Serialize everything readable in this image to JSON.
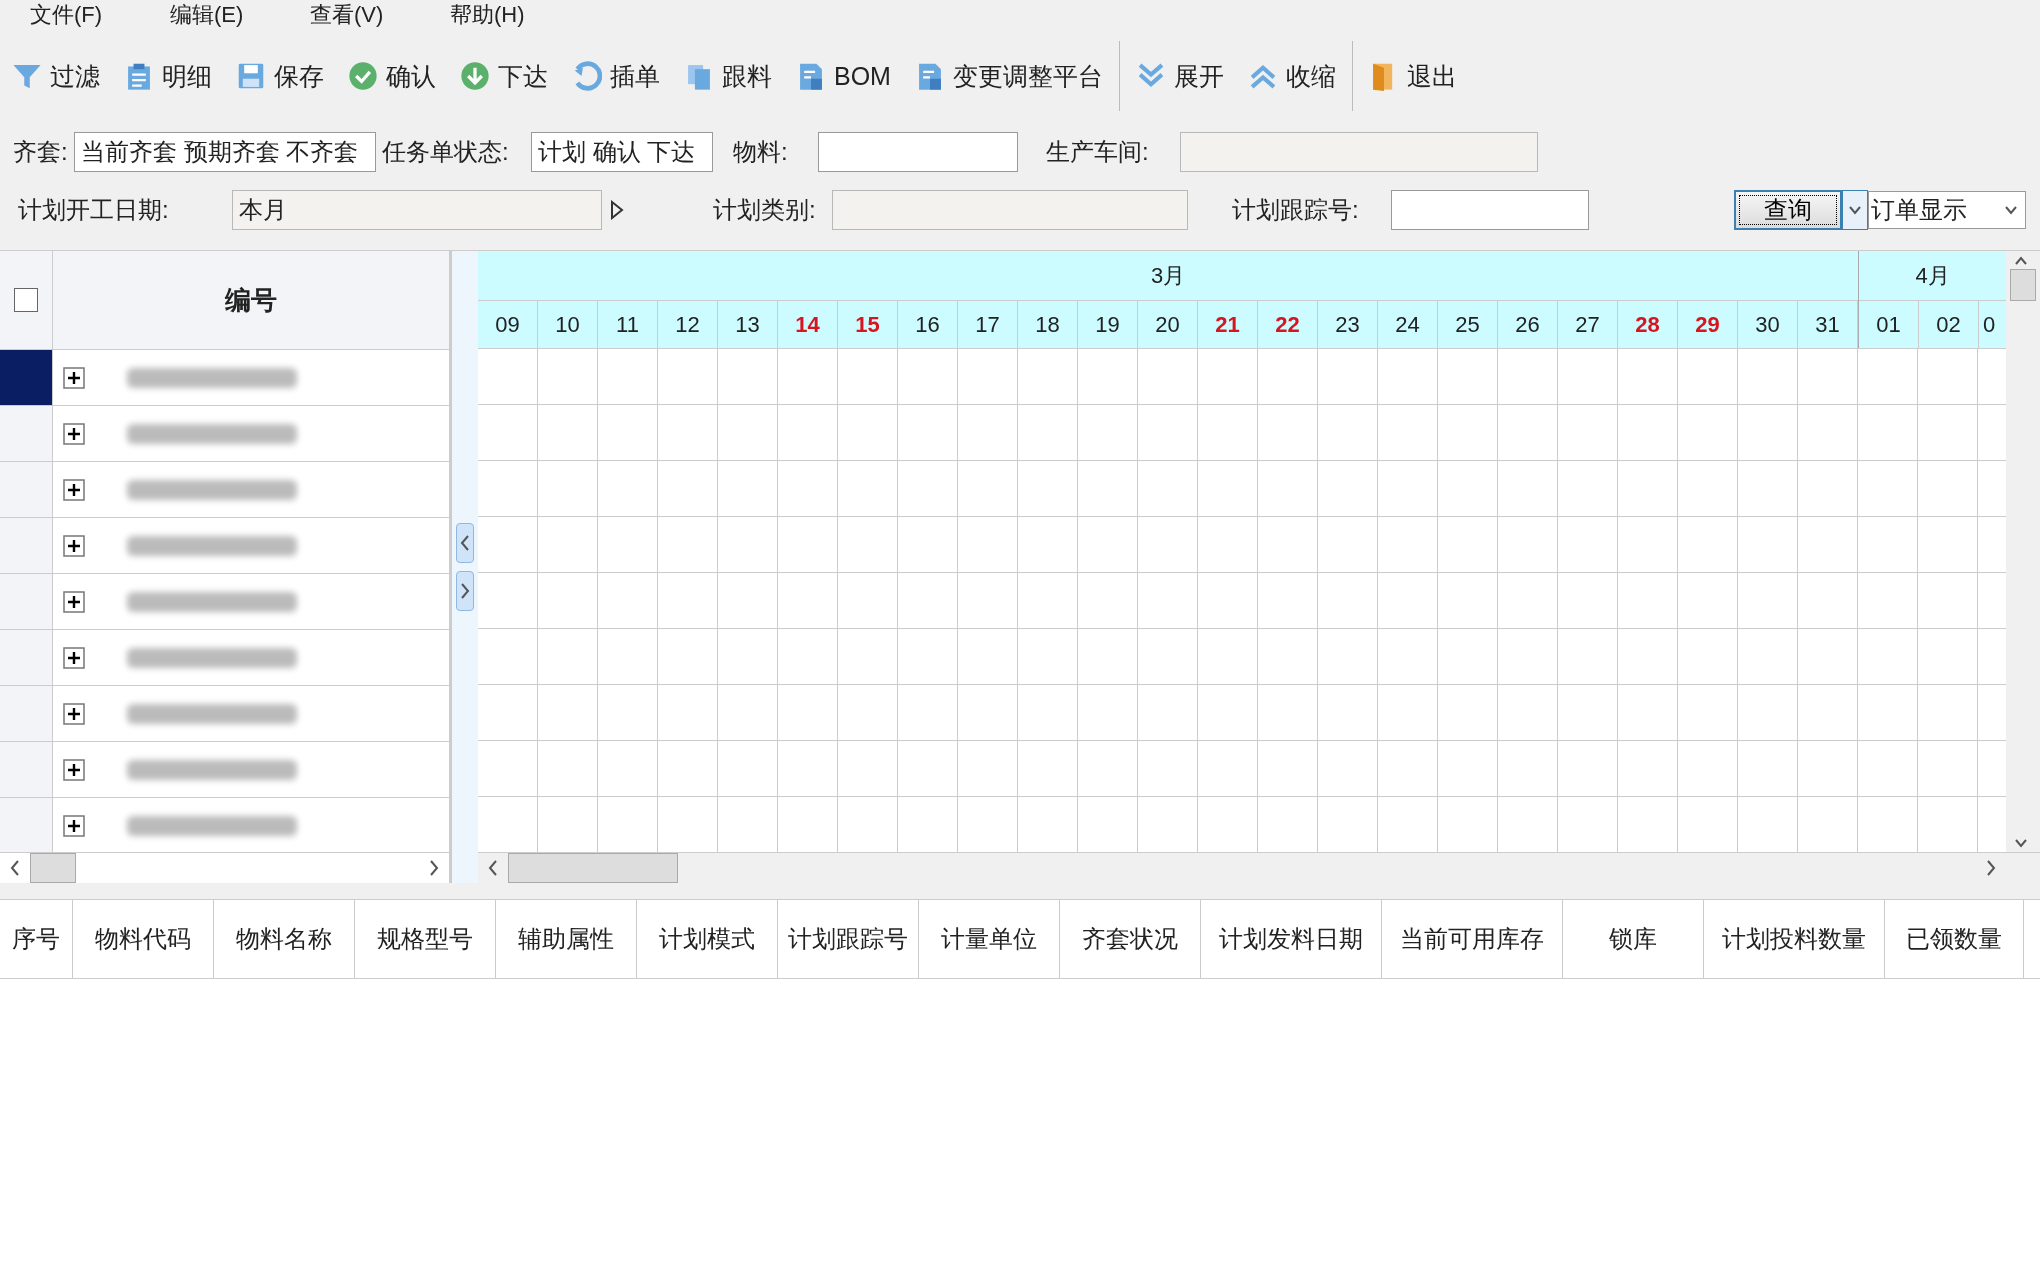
{
  "menu": [
    "文件(F)",
    "编辑(E)",
    "查看(V)",
    "帮助(H)"
  ],
  "toolbar": [
    {
      "kind": "filter",
      "label": "过滤"
    },
    {
      "kind": "clipboard",
      "label": "明细"
    },
    {
      "kind": "save",
      "label": "保存"
    },
    {
      "kind": "check",
      "label": "确认"
    },
    {
      "kind": "down",
      "label": "下达"
    },
    {
      "kind": "insert",
      "label": "插单"
    },
    {
      "kind": "copy",
      "label": "跟料"
    },
    {
      "kind": "doc",
      "label": "BOM"
    },
    {
      "kind": "doc",
      "label": "变更调整平台"
    },
    {
      "kind": "sep"
    },
    {
      "kind": "expand",
      "label": "展开"
    },
    {
      "kind": "collapse",
      "label": "收缩"
    },
    {
      "kind": "sep"
    },
    {
      "kind": "exit",
      "label": "退出"
    }
  ],
  "filters": {
    "row1": [
      {
        "label": "齐套:",
        "value": "当前齐套 预期齐套 不齐套",
        "disabled": false
      },
      {
        "label": "任务单状态:",
        "value": "计划 确认 下达",
        "disabled": false
      },
      {
        "label": "物料:",
        "disabled": false
      },
      {
        "label": "生产车间:",
        "disabled": true
      }
    ],
    "row2": [
      {
        "label": "计划开工日期:",
        "value": "本月",
        "disabled": true,
        "arrow": true
      },
      {
        "label": "计划类别:",
        "disabled": true
      },
      {
        "label": "计划跟踪号:",
        "disabled": false
      }
    ],
    "query_button": "查询",
    "view_select": "订单显示"
  },
  "grid": {
    "header": "编号",
    "checked": false,
    "rows": [
      {
        "selected": true
      },
      {
        "selected": false
      },
      {
        "selected": false
      },
      {
        "selected": false
      },
      {
        "selected": false
      },
      {
        "selected": false
      },
      {
        "selected": false
      },
      {
        "selected": false
      },
      {
        "selected": false
      }
    ]
  },
  "calendar": {
    "months": [
      {
        "label": "3月",
        "days": [
          {
            "label": "09",
            "weekend": false
          },
          {
            "label": "10",
            "weekend": false
          },
          {
            "label": "11",
            "weekend": false
          },
          {
            "label": "12",
            "weekend": false
          },
          {
            "label": "13",
            "weekend": false
          },
          {
            "label": "14",
            "weekend": true
          },
          {
            "label": "15",
            "weekend": true
          },
          {
            "label": "16",
            "weekend": false
          },
          {
            "label": "17",
            "weekend": false
          },
          {
            "label": "18",
            "weekend": false
          },
          {
            "label": "19",
            "weekend": false
          },
          {
            "label": "20",
            "weekend": false
          },
          {
            "label": "21",
            "weekend": true
          },
          {
            "label": "22",
            "weekend": true
          },
          {
            "label": "23",
            "weekend": false
          },
          {
            "label": "24",
            "weekend": false
          },
          {
            "label": "25",
            "weekend": false
          },
          {
            "label": "26",
            "weekend": false
          },
          {
            "label": "27",
            "weekend": false
          },
          {
            "label": "28",
            "weekend": true
          },
          {
            "label": "29",
            "weekend": true
          },
          {
            "label": "30",
            "weekend": false
          },
          {
            "label": "31",
            "weekend": false
          }
        ]
      },
      {
        "label": "4月",
        "days": [
          {
            "label": "01",
            "weekend": false
          },
          {
            "label": "02",
            "weekend": false
          },
          {
            "label": "0",
            "weekend": false
          }
        ]
      }
    ]
  },
  "detail_table": {
    "columns": [
      "序号",
      "物料代码",
      "物料名称",
      "规格型号",
      "辅助属性",
      "计划模式",
      "计划跟踪号",
      "计量单位",
      "齐套状况",
      "计划发料日期",
      "当前可用库存",
      "锁库",
      "计划投料数量",
      "已领数量"
    ]
  }
}
